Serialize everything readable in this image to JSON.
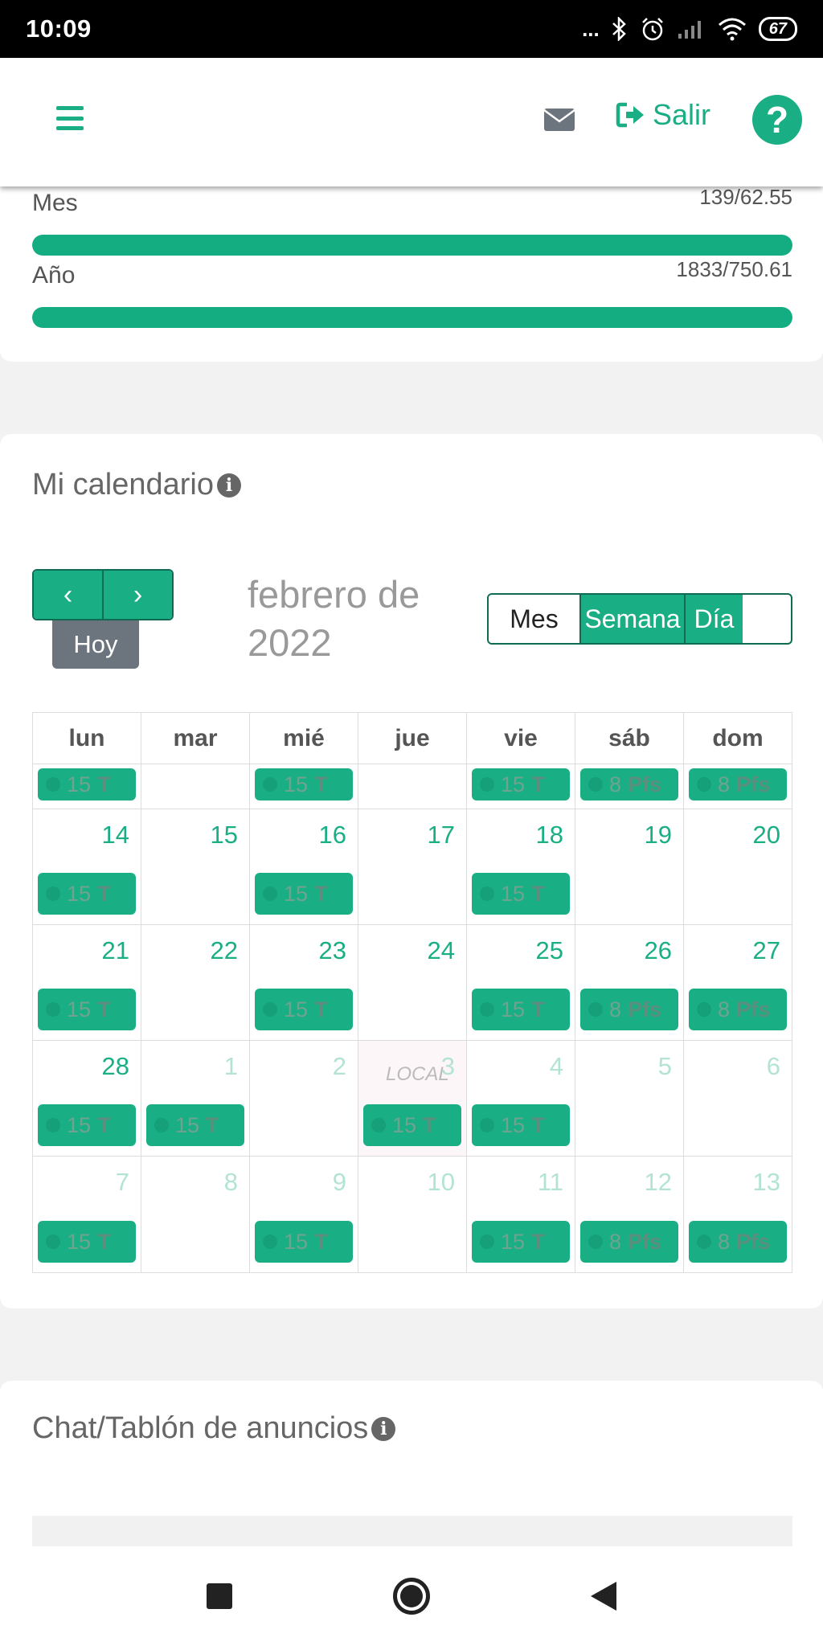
{
  "status_bar": {
    "time": "10:09",
    "dots": "...",
    "battery": "67"
  },
  "header": {
    "logout_label": "Salir",
    "help_label": "?"
  },
  "stats": {
    "month": {
      "label": "Mes",
      "value": "139/62.55",
      "progress_pct": 100
    },
    "year": {
      "label": "Año",
      "value": "1833/750.61",
      "progress_pct": 100
    }
  },
  "calendar": {
    "title": "Mi calendario",
    "info": "i",
    "prev": "‹",
    "next": "›",
    "today": "Hoy",
    "month_label": "febrero de 2022",
    "views": [
      "Mes",
      "Semana",
      "Día"
    ],
    "active_view": "Mes",
    "weekdays": [
      "lun",
      "mar",
      "mié",
      "jue",
      "vie",
      "sáb",
      "dom"
    ],
    "rows": [
      {
        "days": [
          {
            "n": "",
            "ev": [
              "15",
              "T"
            ]
          },
          {
            "n": "",
            "ev": null
          },
          {
            "n": "",
            "ev": [
              "15",
              "T"
            ]
          },
          {
            "n": "",
            "ev": null
          },
          {
            "n": "",
            "ev": [
              "15",
              "T"
            ]
          },
          {
            "n": "",
            "ev": [
              "8",
              "Pfs"
            ]
          },
          {
            "n": "",
            "ev": [
              "8",
              "Pfs"
            ]
          }
        ]
      },
      {
        "days": [
          {
            "n": "14",
            "ev": [
              "15",
              "T"
            ]
          },
          {
            "n": "15",
            "ev": null
          },
          {
            "n": "16",
            "ev": [
              "15",
              "T"
            ]
          },
          {
            "n": "17",
            "ev": null
          },
          {
            "n": "18",
            "ev": [
              "15",
              "T"
            ]
          },
          {
            "n": "19",
            "ev": null
          },
          {
            "n": "20",
            "ev": null
          }
        ]
      },
      {
        "days": [
          {
            "n": "21",
            "ev": [
              "15",
              "T"
            ]
          },
          {
            "n": "22",
            "ev": null
          },
          {
            "n": "23",
            "ev": [
              "15",
              "T"
            ]
          },
          {
            "n": "24",
            "ev": null
          },
          {
            "n": "25",
            "ev": [
              "15",
              "T"
            ]
          },
          {
            "n": "26",
            "ev": [
              "8",
              "Pfs"
            ]
          },
          {
            "n": "27",
            "ev": [
              "8",
              "Pfs"
            ]
          }
        ]
      },
      {
        "days": [
          {
            "n": "28",
            "ev": [
              "15",
              "T"
            ]
          },
          {
            "n": "1",
            "other": true,
            "ev": [
              "15",
              "T"
            ]
          },
          {
            "n": "2",
            "other": true,
            "ev": null
          },
          {
            "n": "3",
            "other": true,
            "local": "LOCAL",
            "ev": [
              "15",
              "T"
            ]
          },
          {
            "n": "4",
            "other": true,
            "ev": [
              "15",
              "T"
            ]
          },
          {
            "n": "5",
            "other": true,
            "ev": null
          },
          {
            "n": "6",
            "other": true,
            "ev": null
          }
        ]
      },
      {
        "days": [
          {
            "n": "7",
            "other": true,
            "ev": [
              "15",
              "T"
            ]
          },
          {
            "n": "8",
            "other": true,
            "ev": null
          },
          {
            "n": "9",
            "other": true,
            "ev": [
              "15",
              "T"
            ]
          },
          {
            "n": "10",
            "other": true,
            "ev": null
          },
          {
            "n": "11",
            "other": true,
            "ev": [
              "15",
              "T"
            ]
          },
          {
            "n": "12",
            "other": true,
            "ev": [
              "8",
              "Pfs"
            ]
          },
          {
            "n": "13",
            "other": true,
            "ev": [
              "8",
              "Pfs"
            ]
          }
        ]
      }
    ]
  },
  "chat": {
    "title": "Chat/Tablón de anuncios",
    "info": "i"
  },
  "colors": {
    "accent": "#1aae85",
    "bar": "#13ad81"
  }
}
